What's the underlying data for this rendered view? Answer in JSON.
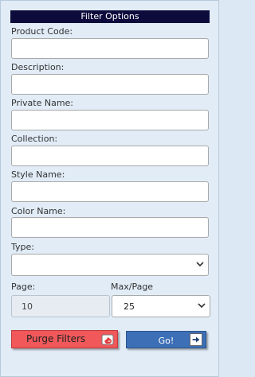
{
  "header": {
    "title": "Filter Options"
  },
  "fields": {
    "product_code": {
      "label": "Product Code:",
      "value": ""
    },
    "description": {
      "label": "Description:",
      "value": ""
    },
    "private_name": {
      "label": "Private Name:",
      "value": ""
    },
    "collection": {
      "label": "Collection:",
      "value": ""
    },
    "style_name": {
      "label": "Style Name:",
      "value": ""
    },
    "color_name": {
      "label": "Color Name:",
      "value": ""
    },
    "type": {
      "label": "Type:",
      "value": ""
    }
  },
  "paging": {
    "page_label": "Page:",
    "page_value": "10",
    "maxpage_label": "Max/Page",
    "maxpage_value": "25"
  },
  "buttons": {
    "purge_label": "Purge Filters",
    "go_label": "Go!"
  },
  "colors": {
    "header_bg": "#0d0b3c",
    "purge_bg": "#f0585a",
    "go_bg": "#3c6fb6",
    "panel_bg": "#e1ecf7"
  },
  "icons": {
    "purge": "eraser-icon",
    "go": "arrow-right-icon",
    "dropdown": "chevron-down-icon"
  }
}
